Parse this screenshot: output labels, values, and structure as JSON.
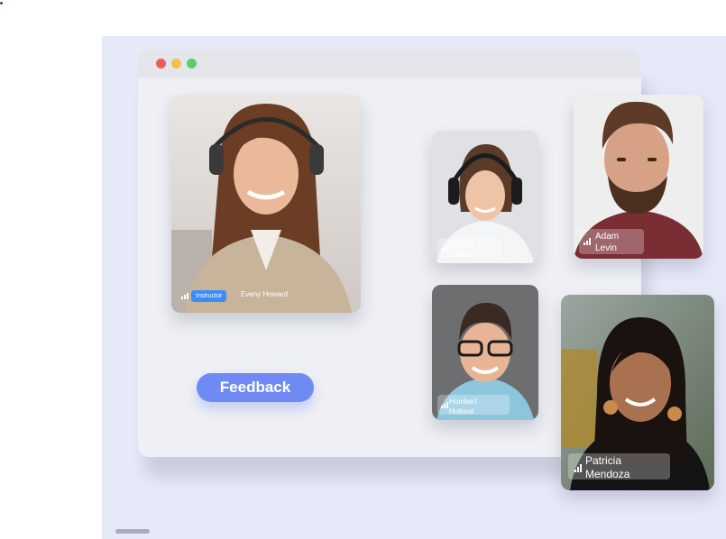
{
  "window": {
    "traffic_lights": [
      "#f05a59",
      "#f5be4f",
      "#57d06b"
    ]
  },
  "instructor_tile": {
    "badge": "Instructor",
    "name": "Eveny Howard",
    "signal_icon": "signal-bars-icon"
  },
  "participants": [
    {
      "name_line1": "Tamara",
      "name_line2": "Clarke"
    },
    {
      "name_line1": "Adam",
      "name_line2": "Levin"
    },
    {
      "name_line1": "Humbert",
      "name_line2": "Holland"
    },
    {
      "name_line1": "Patricia",
      "name_line2": "Mendoza"
    }
  ],
  "feedback_button": {
    "label": "Feedback"
  },
  "colors": {
    "accent": "#6f8bf3",
    "badge": "#3a8cf6",
    "backdrop": "#e6e9f8"
  }
}
